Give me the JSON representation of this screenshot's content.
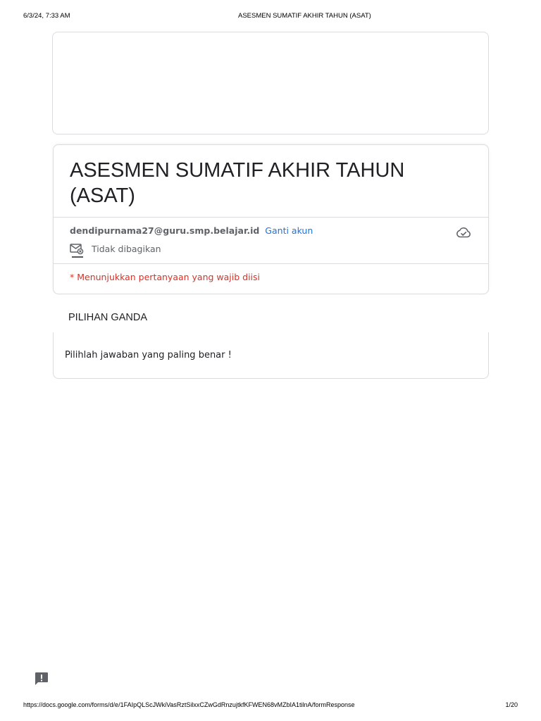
{
  "print_header": {
    "datetime": "6/3/24, 7:33 AM",
    "title": "ASESMEN SUMATIF AKHIR TAHUN (ASAT)"
  },
  "form": {
    "title": "ASESMEN SUMATIF AKHIR TAHUN (ASAT)",
    "account_email": "dendipurnama27@guru.smp.belajar.id",
    "switch_account_label": "Ganti akun",
    "share_status": "Tidak dibagikan",
    "required_note": "* Menunjukkan pertanyaan yang wajib diisi"
  },
  "section": {
    "title": "PILIHAN GANDA",
    "description": "Pilihlah jawaban yang paling benar !"
  },
  "print_footer": {
    "url": "https://docs.google.com/forms/d/e/1FAIpQLScJWkiVasRztSilxxCZwGdRnzujtkfKFWEN68vMZbIA1tilnA/formResponse",
    "page": "1/20"
  },
  "icons": {
    "cloud": "cloud-check-icon",
    "share": "mail-not-shared-icon",
    "feedback": "feedback-icon"
  },
  "colors": {
    "link": "#1a73e8",
    "required": "#d93025",
    "secondary_text": "#5f6368",
    "border": "#dadce0"
  }
}
